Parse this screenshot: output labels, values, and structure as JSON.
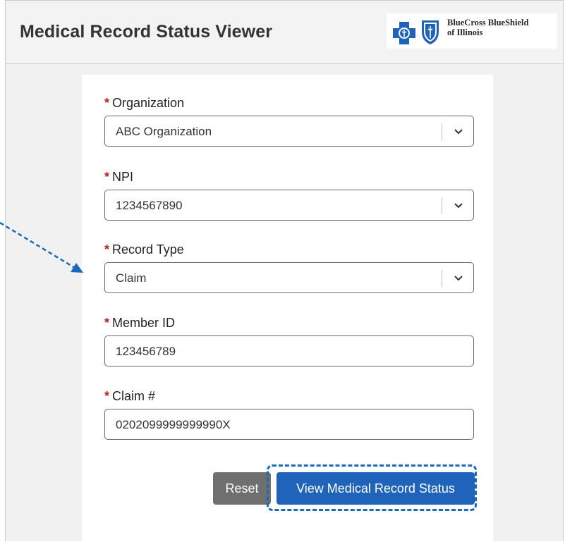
{
  "header": {
    "title": "Medical Record Status Viewer",
    "logo_text_line1": "BlueCross BlueShield",
    "logo_text_line2": "of Illinois"
  },
  "form": {
    "fields": [
      {
        "label": "Organization",
        "value": "ABC Organization",
        "type": "select"
      },
      {
        "label": "NPI",
        "value": "1234567890",
        "type": "select"
      },
      {
        "label": "Record Type",
        "value": "Claim",
        "type": "select"
      },
      {
        "label": "Member ID",
        "value": "123456789",
        "type": "text"
      },
      {
        "label": "Claim #",
        "value": "0202099999999990X",
        "type": "text"
      }
    ],
    "required_marker": "*",
    "reset_label": "Reset",
    "submit_label": "View Medical Record Status"
  },
  "colors": {
    "brand_blue": "#1f64ba",
    "required_red": "#c0211f",
    "annotation_blue": "#1a6ab8",
    "reset_gray": "#6f6f6f"
  },
  "icons": [
    "bluecross-logo-icon",
    "blueshield-logo-icon",
    "chevron-down-icon",
    "annotation-arrow"
  ]
}
